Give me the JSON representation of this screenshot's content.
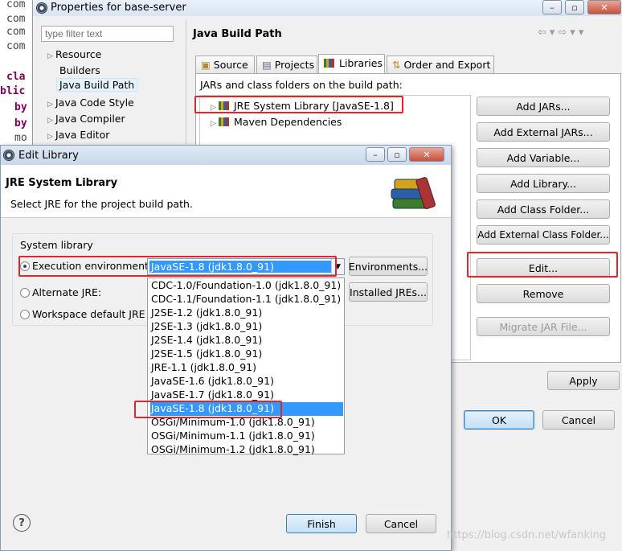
{
  "editor": {
    "lines": [
      "com",
      "com",
      "com",
      "com",
      "cla",
      "blic",
      "by",
      "by",
      "mo"
    ]
  },
  "props": {
    "title": "Properties for base-server",
    "filter_placeholder": "type filter text",
    "tree": [
      {
        "label": "Resource",
        "expandable": true
      },
      {
        "label": "Builders",
        "expandable": false
      },
      {
        "label": "Java Build Path",
        "expandable": false,
        "selected": true
      },
      {
        "label": "Java Code Style",
        "expandable": true
      },
      {
        "label": "Java Compiler",
        "expandable": true
      },
      {
        "label": "Java Editor",
        "expandable": true
      }
    ],
    "page_title": "Java Build Path",
    "tabs": [
      "Source",
      "Projects",
      "Libraries",
      "Order and Export"
    ],
    "active_tab": "Libraries",
    "jars_label": "JARs and class folders on the build path:",
    "entries": [
      "JRE System Library [JavaSE-1.8]",
      "Maven Dependencies"
    ],
    "buttons": [
      "Add JARs...",
      "Add External JARs...",
      "Add Variable...",
      "Add Library...",
      "Add Class Folder...",
      "Add External Class Folder...",
      "Edit...",
      "Remove",
      "Migrate JAR File..."
    ],
    "apply": "Apply",
    "ok": "OK",
    "cancel": "Cancel"
  },
  "dialog": {
    "title": "Edit Library",
    "heading": "JRE System Library",
    "subtitle": "Select JRE for the project build path.",
    "group_label": "System library",
    "radio_exec": "Execution environment:",
    "radio_alt": "Alternate JRE:",
    "radio_ws": "Workspace default JRE (j",
    "selected_env": "JavaSE-1.8 (jdk1.8.0_91)",
    "environments_btn": "Environments...",
    "installed_btn": "Installed JREs...",
    "options": [
      "CDC-1.0/Foundation-1.0 (jdk1.8.0_91)",
      "CDC-1.1/Foundation-1.1 (jdk1.8.0_91)",
      "J2SE-1.2 (jdk1.8.0_91)",
      "J2SE-1.3 (jdk1.8.0_91)",
      "J2SE-1.4 (jdk1.8.0_91)",
      "J2SE-1.5 (jdk1.8.0_91)",
      "JRE-1.1 (jdk1.8.0_91)",
      "JavaSE-1.6 (jdk1.8.0_91)",
      "JavaSE-1.7 (jdk1.8.0_91)",
      "JavaSE-1.8 (jdk1.8.0_91)",
      "OSGi/Minimum-1.0 (jdk1.8.0_91)",
      "OSGi/Minimum-1.1 (jdk1.8.0_91)",
      "OSGi/Minimum-1.2 (jdk1.8.0_91)"
    ],
    "selected_index": 9,
    "help": "?",
    "finish": "Finish",
    "cancel": "Cancel"
  },
  "watermark": "https://blog.csdn.net/wfanking",
  "colors": {
    "selection": "#3399ff",
    "highlight_box": "#e0252d"
  }
}
